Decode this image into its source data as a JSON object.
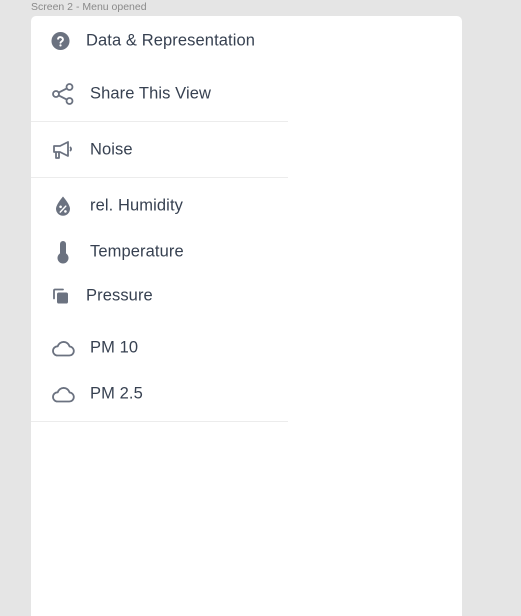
{
  "frame": {
    "label": "Screen 2 - Menu opened"
  },
  "menu": {
    "items": [
      {
        "label": "Data & Representation",
        "icon": "question-circle-icon"
      },
      {
        "label": "Share This View",
        "icon": "share-icon"
      },
      {
        "label": "Noise",
        "icon": "megaphone-icon"
      },
      {
        "label": "rel. Humidity",
        "icon": "humidity-drop-icon"
      },
      {
        "label": "Temperature",
        "icon": "thermometer-icon"
      },
      {
        "label": "Pressure",
        "icon": "pressure-icon"
      },
      {
        "label": "PM 10",
        "icon": "cloud-icon"
      },
      {
        "label": "PM 2.5",
        "icon": "cloud-icon"
      }
    ]
  },
  "colors": {
    "background": "#e5e5e5",
    "panel": "#ffffff",
    "text": "#374151",
    "icon": "#6b7280",
    "divider": "#ececec"
  }
}
